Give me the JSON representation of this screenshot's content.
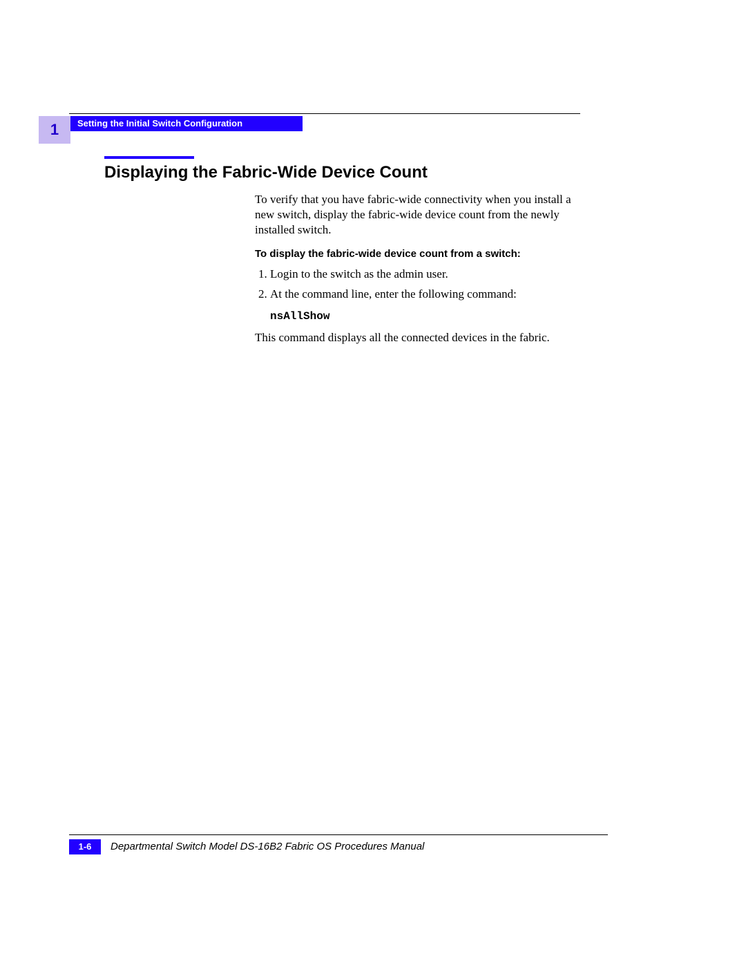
{
  "chapter_number": "1",
  "header_title": "Setting the Initial Switch Configuration",
  "section_title": "Displaying the Fabric-Wide Device Count",
  "intro_paragraph": "To verify that you have fabric-wide connectivity when you install a new switch, display the fabric-wide device count from the newly installed switch.",
  "procedure_heading": "To display the fabric-wide device count from a switch:",
  "steps": [
    "Login to the switch as the admin user.",
    "At the command line, enter the following command:"
  ],
  "command": "nsAllShow",
  "result_paragraph": "This command displays all the connected devices in the fabric.",
  "footer_page": "1-6",
  "footer_title": "Departmental Switch Model DS-16B2 Fabric OS Procedures Manual"
}
